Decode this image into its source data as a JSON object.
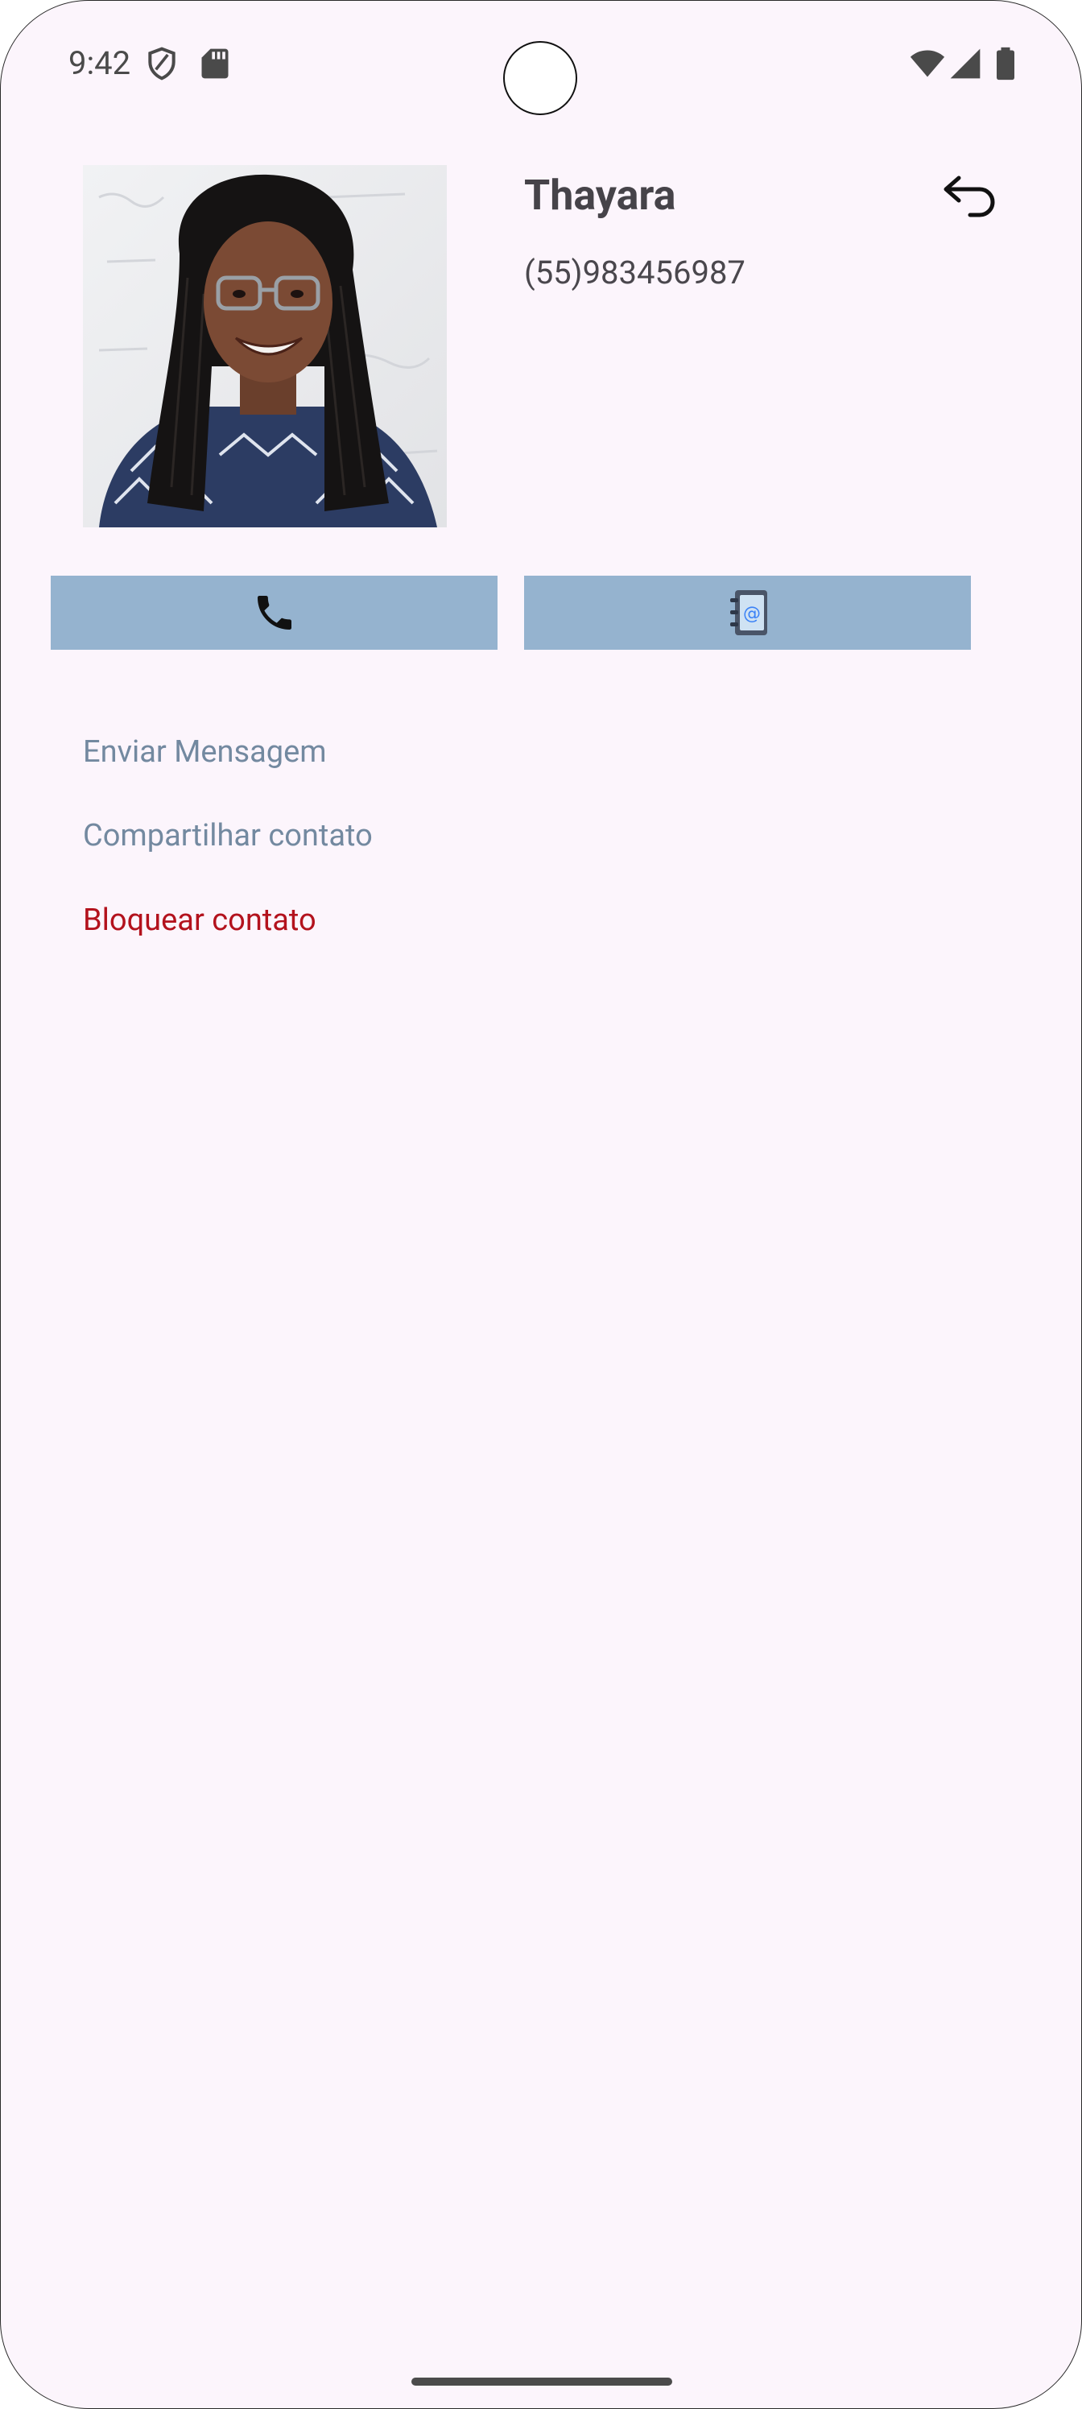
{
  "status_bar": {
    "time": "9:42",
    "left_icons": [
      "shield-icon",
      "sd-card-icon"
    ],
    "right_icons": [
      "wifi-icon",
      "signal-icon",
      "battery-icon"
    ]
  },
  "contact": {
    "name": "Thayara",
    "phone": "(55)983456987",
    "photo_icon": "contact-photo"
  },
  "actions": {
    "call_icon": "phone-icon",
    "agenda_icon": "contact-book-icon",
    "back_icon": "undo-arrow-icon",
    "button_color": "#95b3cf"
  },
  "menu": {
    "send_message": "Enviar Mensagem",
    "share_contact": "Compartilhar contato",
    "block_contact": "Bloquear contato"
  },
  "colors": {
    "background": "#fcf5fc",
    "muted_text": "#7389a0",
    "danger_text": "#b3121d"
  }
}
